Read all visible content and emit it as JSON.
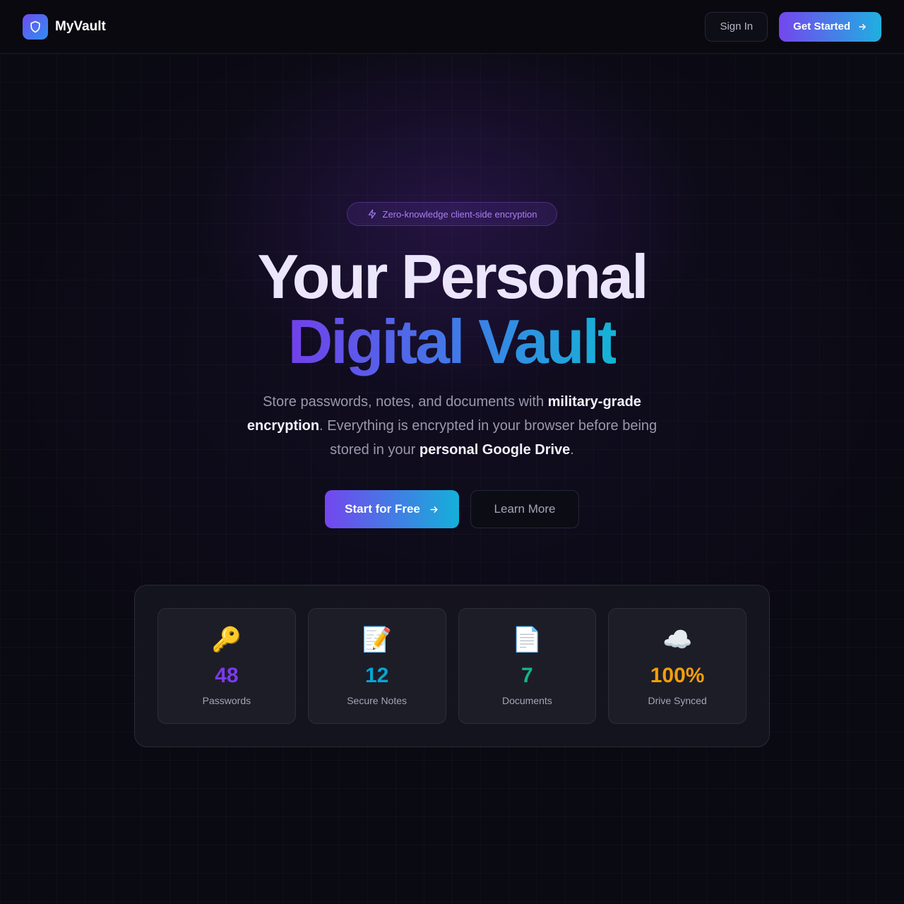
{
  "header": {
    "brand_name": "MyVault",
    "sign_in_label": "Sign In",
    "get_started_label": "Get Started"
  },
  "hero": {
    "badge_text": "Zero-knowledge client-side encryption",
    "title_line1": "Your Personal",
    "title_line2": "Digital Vault",
    "subtitle": {
      "part1": "Store passwords, notes, and documents with ",
      "bold1": "military-grade encryption",
      "part2": ". Everything is encrypted in your browser before being stored in your ",
      "bold2": "personal Google Drive",
      "part3": "."
    },
    "primary_cta_label": "Start for Free",
    "secondary_cta_label": "Learn More"
  },
  "stats": [
    {
      "icon": "key-icon",
      "glyph": "🔑",
      "value": "48",
      "label": "Passwords",
      "color": "#7c3aed"
    },
    {
      "icon": "memo-icon",
      "glyph": "📝",
      "value": "12",
      "label": "Secure Notes",
      "color": "#06a6d4"
    },
    {
      "icon": "document-icon",
      "glyph": "📄",
      "value": "7",
      "label": "Documents",
      "color": "#10b981"
    },
    {
      "icon": "cloud-icon",
      "glyph": "☁️",
      "value": "100%",
      "label": "Drive Synced",
      "color": "#f59e0b"
    }
  ],
  "colors": {
    "accent_purple": "#7446ee",
    "accent_cyan": "#14b0da",
    "background": "#0a0a12"
  }
}
